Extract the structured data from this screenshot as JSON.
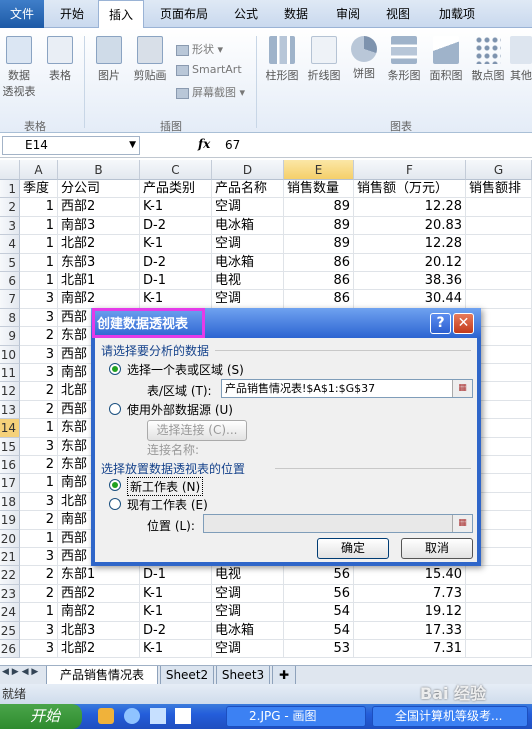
{
  "ribbon": {
    "tabs": [
      "文件",
      "开始",
      "插入",
      "页面布局",
      "公式",
      "数据",
      "审阅",
      "视图",
      "加载项"
    ],
    "active_tab": "插入",
    "groups": {
      "tables": {
        "label": "表格",
        "buttons": [
          "数据\n透视表",
          "表格"
        ]
      },
      "illustrations": {
        "label": "插图",
        "buttons": [
          "图片",
          "剪贴画"
        ],
        "small": [
          "形状",
          "SmartArt",
          "屏幕截图"
        ]
      },
      "charts": {
        "label": "图表",
        "buttons": [
          "柱形图",
          "折线图",
          "饼图",
          "条形图",
          "面积图",
          "散点图",
          "其他"
        ]
      }
    }
  },
  "formula_bar": {
    "name_box": "E14",
    "fx": "fx",
    "content": "67"
  },
  "columns": [
    "A",
    "B",
    "C",
    "D",
    "E",
    "F",
    "G"
  ],
  "selected_column": "E",
  "selected_row": 14,
  "rows": [
    {
      "n": "1",
      "a": "季度",
      "b": "分公司",
      "c": "产品类别",
      "d": "产品名称",
      "e": "销售数量",
      "f": "销售额（万元）",
      "g": "销售额排"
    },
    {
      "n": "2",
      "a": "1",
      "b": "西部2",
      "c": "K-1",
      "d": "空调",
      "e": "89",
      "f": "12.28"
    },
    {
      "n": "3",
      "a": "1",
      "b": "南部3",
      "c": "D-2",
      "d": "电冰箱",
      "e": "89",
      "f": "20.83"
    },
    {
      "n": "4",
      "a": "1",
      "b": "北部2",
      "c": "K-1",
      "d": "空调",
      "e": "89",
      "f": "12.28"
    },
    {
      "n": "5",
      "a": "1",
      "b": "东部3",
      "c": "D-2",
      "d": "电冰箱",
      "e": "86",
      "f": "20.12"
    },
    {
      "n": "6",
      "a": "1",
      "b": "北部1",
      "c": "D-1",
      "d": "电视",
      "e": "86",
      "f": "38.36"
    },
    {
      "n": "7",
      "a": "3",
      "b": "南部2",
      "c": "K-1",
      "d": "空调",
      "e": "86",
      "f": "30.44"
    },
    {
      "n": "8",
      "a": "3",
      "b": "西部"
    },
    {
      "n": "9",
      "a": "2",
      "b": "东部"
    },
    {
      "n": "10",
      "a": "3",
      "b": "西部"
    },
    {
      "n": "11",
      "a": "3",
      "b": "南部"
    },
    {
      "n": "12",
      "a": "2",
      "b": "北部"
    },
    {
      "n": "13",
      "a": "2",
      "b": "西部"
    },
    {
      "n": "14",
      "a": "1",
      "b": "东部"
    },
    {
      "n": "15",
      "a": "3",
      "b": "东部"
    },
    {
      "n": "16",
      "a": "2",
      "b": "东部"
    },
    {
      "n": "17",
      "a": "1",
      "b": "南部"
    },
    {
      "n": "18",
      "a": "3",
      "b": "北部"
    },
    {
      "n": "19",
      "a": "2",
      "b": "南部"
    },
    {
      "n": "20",
      "a": "1",
      "b": "西部"
    },
    {
      "n": "21",
      "a": "3",
      "b": "西部"
    },
    {
      "n": "22",
      "a": "2",
      "b": "东部1",
      "c": "D-1",
      "d": "电视",
      "e": "56",
      "f": "15.40"
    },
    {
      "n": "23",
      "a": "2",
      "b": "西部2",
      "c": "K-1",
      "d": "空调",
      "e": "56",
      "f": "7.73"
    },
    {
      "n": "24",
      "a": "1",
      "b": "南部2",
      "c": "K-1",
      "d": "空调",
      "e": "54",
      "f": "19.12"
    },
    {
      "n": "25",
      "a": "3",
      "b": "北部3",
      "c": "D-2",
      "d": "电冰箱",
      "e": "54",
      "f": "17.33"
    },
    {
      "n": "26",
      "a": "3",
      "b": "北部2",
      "c": "K-1",
      "d": "空调",
      "e": "53",
      "f": "7.31"
    }
  ],
  "sheets": {
    "tabs": [
      "产品销售情况表",
      "Sheet2",
      "Sheet3"
    ],
    "active": "产品销售情况表"
  },
  "status": "就绪",
  "dialog": {
    "title": "创建数据透视表",
    "help": "?",
    "close": "✕",
    "section1": "请选择要分析的数据",
    "opt_range": "选择一个表或区域 (S)",
    "range_label": "表/区域 (T):",
    "range_value": "产品销售情况表!$A$1:$G$37",
    "opt_external": "使用外部数据源 (U)",
    "choose_conn": "选择连接 (C)...",
    "conn_name": "连接名称:",
    "section2": "选择放置数据透视表的位置",
    "opt_new": "新工作表 (N)",
    "opt_existing": "现有工作表 (E)",
    "location_label": "位置 (L):",
    "ok": "确定",
    "cancel": "取消"
  },
  "taskbar": {
    "start": "开始",
    "items": [
      "2.JPG - 画图",
      "全国计算机等级考..."
    ]
  },
  "watermark": "Bai 经验"
}
